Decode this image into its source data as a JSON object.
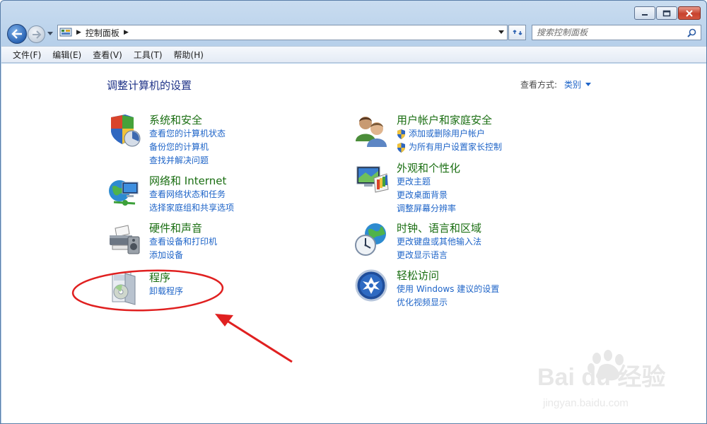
{
  "window": {
    "caption_buttons": [
      "minimize",
      "maximize",
      "close"
    ]
  },
  "address_bar": {
    "path": [
      "控制面板"
    ],
    "search_placeholder": "搜索控制面板"
  },
  "menu": [
    "文件(F)",
    "编辑(E)",
    "查看(V)",
    "工具(T)",
    "帮助(H)"
  ],
  "main": {
    "title": "调整计算机的设置",
    "view_by_label": "查看方式:",
    "view_by_value": "类别"
  },
  "categories": {
    "system_security": {
      "title": "系统和安全",
      "icon": "shield-icon",
      "links": [
        "查看您的计算机状态",
        "备份您的计算机",
        "查找并解决问题"
      ]
    },
    "network": {
      "title": "网络和 Internet",
      "icon": "globe-network-icon",
      "links": [
        "查看网络状态和任务",
        "选择家庭组和共享选项"
      ]
    },
    "hardware": {
      "title": "硬件和声音",
      "icon": "printer-icon",
      "links": [
        "查看设备和打印机",
        "添加设备"
      ]
    },
    "programs": {
      "title": "程序",
      "icon": "programs-disc-icon",
      "links": [
        "卸载程序"
      ]
    },
    "user_accounts": {
      "title": "用户帐户和家庭安全",
      "icon": "users-icon",
      "links": [
        "添加或删除用户帐户",
        "为所有用户设置家长控制"
      ]
    },
    "appearance": {
      "title": "外观和个性化",
      "icon": "monitor-palette-icon",
      "links": [
        "更改主题",
        "更改桌面背景",
        "调整屏幕分辨率"
      ]
    },
    "clock_region": {
      "title": "时钟、语言和区域",
      "icon": "clock-globe-icon",
      "links": [
        "更改键盘或其他输入法",
        "更改显示语言"
      ]
    },
    "ease_of_access": {
      "title": "轻松访问",
      "icon": "ease-of-access-icon",
      "links": [
        "使用 Windows 建议的设置",
        "优化视频显示"
      ]
    }
  },
  "watermark": {
    "brand": "Bai du 经验",
    "url": "jingyan.baidu.com"
  },
  "colors": {
    "link": "#1e64c8",
    "category_title": "#1a6e12",
    "page_title": "#1e3287",
    "annotation": "#e02020"
  }
}
